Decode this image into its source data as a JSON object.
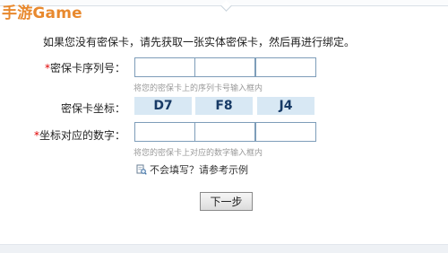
{
  "brand": "手游Game",
  "instruction": "如果您没有密保卡，请先获取一张实体密保卡，然后再进行绑定。",
  "serial": {
    "required_mark": "*",
    "label": "密保卡序列号：",
    "hint": "将您的密保卡上的序列卡号输入框内",
    "values": [
      "",
      "",
      ""
    ]
  },
  "coords": {
    "label": "密保卡坐标：",
    "items": [
      "D7",
      "F8",
      "J4"
    ]
  },
  "digits": {
    "required_mark": "*",
    "label": "坐标对应的数字：",
    "hint": "将您的密保卡上对应的数字输入框内",
    "values": [
      "",
      "",
      ""
    ]
  },
  "help": {
    "icon": "document-search-icon",
    "text": "不会填写？请参考示例"
  },
  "next_button": "下一步"
}
